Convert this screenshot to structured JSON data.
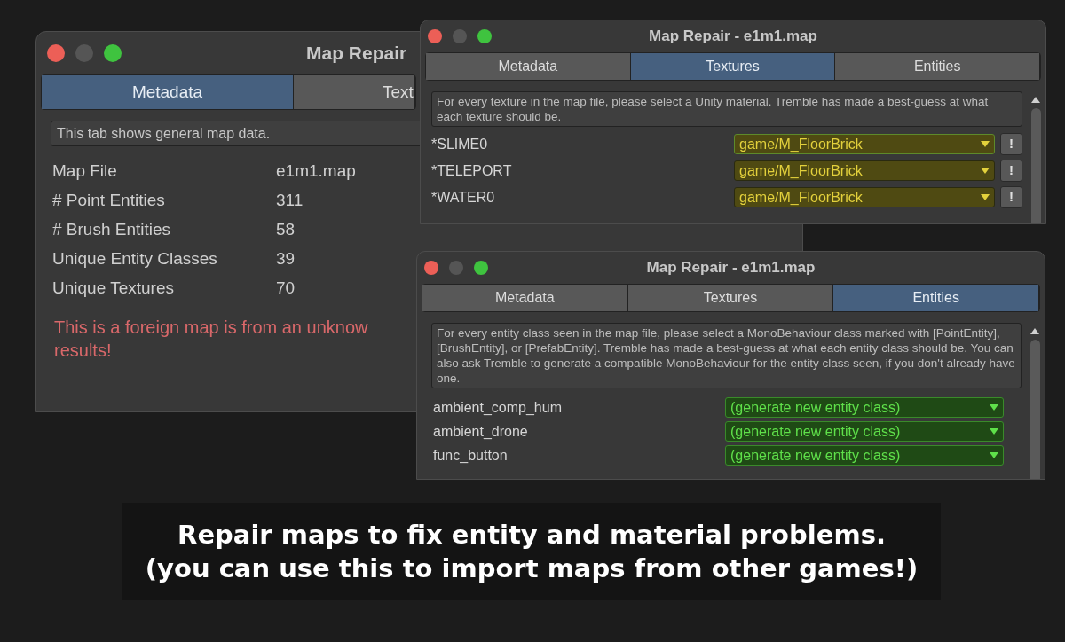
{
  "windows": [
    {
      "title": "Map Repair",
      "tabs": [
        {
          "label": "Metadata",
          "selected": true
        },
        {
          "label": "Text",
          "selected": false
        }
      ],
      "info": "This tab shows general map data.",
      "fields": [
        {
          "label": "Map File",
          "value": "e1m1.map"
        },
        {
          "label": "# Point Entities",
          "value": "311"
        },
        {
          "label": "# Brush Entities",
          "value": "58"
        },
        {
          "label": "Unique Entity Classes",
          "value": "39"
        },
        {
          "label": "Unique Textures",
          "value": "70"
        }
      ],
      "warning_lines": [
        "This is a foreign map is from an unknow",
        "results!"
      ]
    },
    {
      "title": "Map Repair - e1m1.map",
      "tabs": [
        {
          "label": "Metadata",
          "selected": false
        },
        {
          "label": "Textures",
          "selected": true
        },
        {
          "label": "Entities",
          "selected": false
        }
      ],
      "info": "For every texture in the map file, please select a Unity material. Tremble has made a best-guess at what each texture should be.",
      "rows": [
        {
          "name": "*SLIME0",
          "value": "game/M_FloorBrick",
          "kind": "material",
          "focused": true,
          "button": "!"
        },
        {
          "name": "*TELEPORT",
          "value": "game/M_FloorBrick",
          "kind": "material",
          "focused": false,
          "button": "!"
        },
        {
          "name": "*WATER0",
          "value": "game/M_FloorBrick",
          "kind": "material",
          "focused": false,
          "button": "!"
        }
      ]
    },
    {
      "title": "Map Repair - e1m1.map",
      "tabs": [
        {
          "label": "Metadata",
          "selected": false
        },
        {
          "label": "Textures",
          "selected": false
        },
        {
          "label": "Entities",
          "selected": true
        }
      ],
      "info": "For every entity class seen in the map file, please select a MonoBehaviour class marked with [PointEntity], [BrushEntity], or [PrefabEntity]. Tremble has made a best-guess at what each entity class should be. You can also ask Tremble to generate a compatible MonoBehaviour for the entity class seen, if you don't already have one.",
      "rows": [
        {
          "name": "ambient_comp_hum",
          "value": "(generate new entity class)",
          "kind": "entity",
          "focused": false
        },
        {
          "name": "ambient_drone",
          "value": "(generate new entity class)",
          "kind": "entity",
          "focused": false
        },
        {
          "name": "func_button",
          "value": "(generate new entity class)",
          "kind": "entity",
          "focused": false
        }
      ]
    }
  ],
  "caption_lines": [
    "Repair maps to fix entity and material problems.",
    "(you can use this to import maps from other games!)"
  ]
}
